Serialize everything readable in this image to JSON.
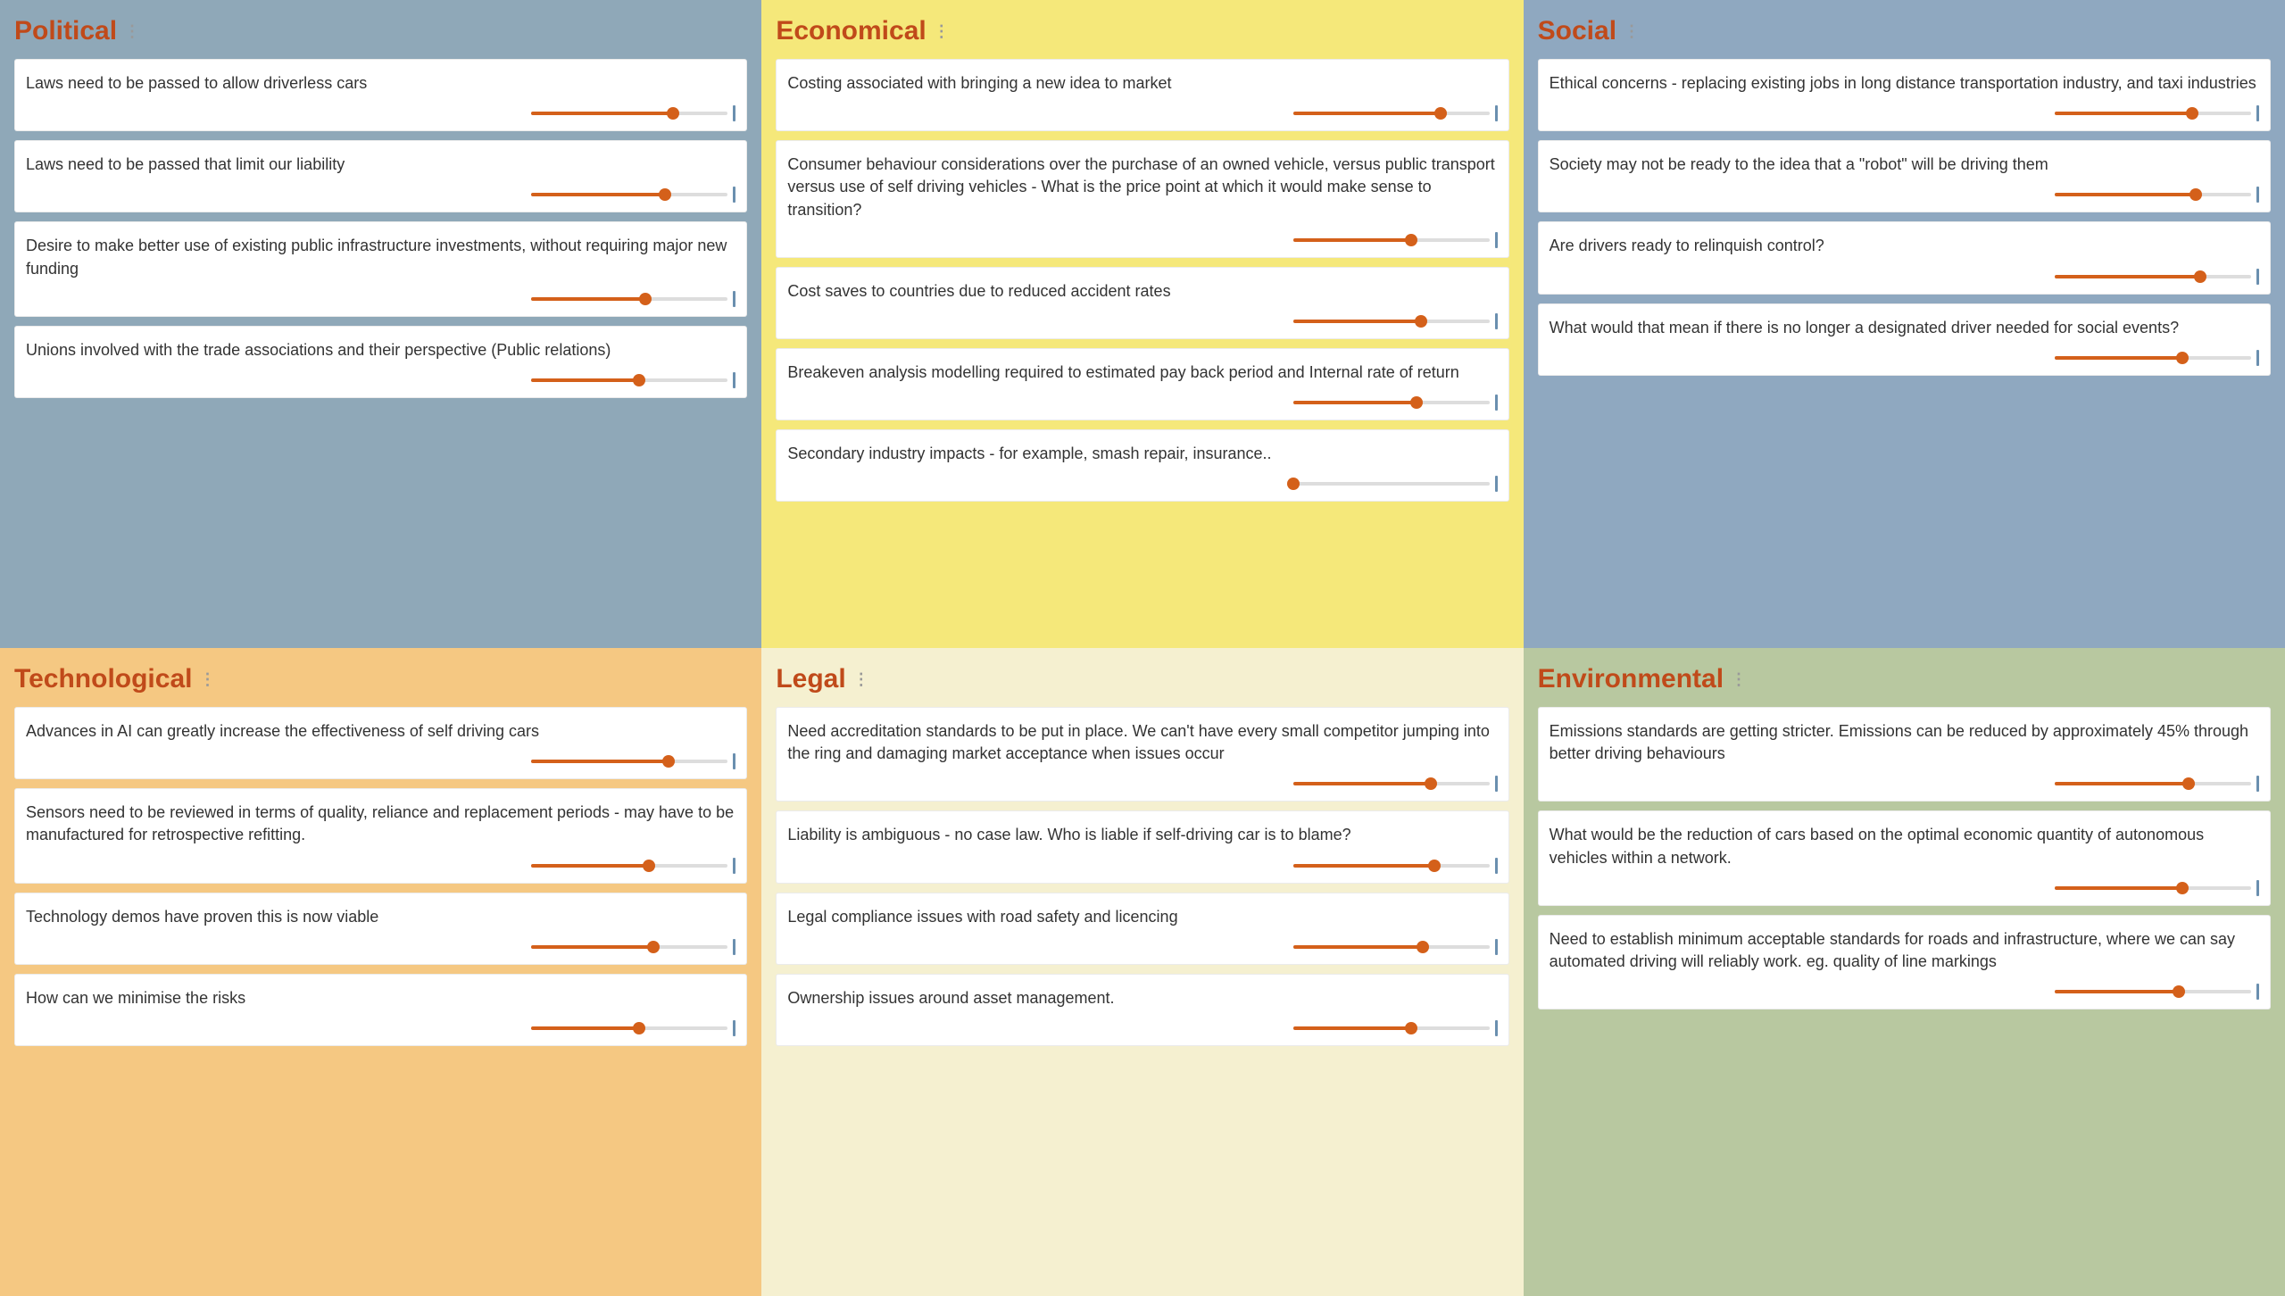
{
  "columns": [
    {
      "id": "political",
      "label": "Political",
      "colorClass": "col-political",
      "cards": [
        {
          "text": "Laws need to be passed to allow driverless cars",
          "sliderPos": 72
        },
        {
          "text": "Laws need to be passed that limit our liability",
          "sliderPos": 68
        },
        {
          "text": "Desire to make better use of existing public infrastructure investments, without requiring major new funding",
          "sliderPos": 58
        },
        {
          "text": "Unions involved with the trade associations and their perspective (Public relations)",
          "sliderPos": 55
        }
      ]
    },
    {
      "id": "economical",
      "label": "Economical",
      "colorClass": "col-economical",
      "cards": [
        {
          "text": "Costing associated with bringing a new idea to market",
          "sliderPos": 75
        },
        {
          "text": "Consumer behaviour considerations over the purchase of an owned vehicle, versus public transport versus use of self driving vehicles - What is the price point at which it would make sense to transition?",
          "sliderPos": 60
        },
        {
          "text": "Cost saves to countries due to reduced accident rates",
          "sliderPos": 65
        },
        {
          "text": "Breakeven analysis modelling required to estimated pay back period and Internal rate of return",
          "sliderPos": 63
        },
        {
          "text": "Secondary industry impacts - for example, smash repair, insurance..",
          "sliderPos": 0
        }
      ]
    },
    {
      "id": "social",
      "label": "Social",
      "colorClass": "col-social",
      "cards": [
        {
          "text": "Ethical concerns - replacing existing jobs in long distance transportation industry, and taxi industries",
          "sliderPos": 70
        },
        {
          "text": "Society may not be ready to the idea that a \"robot\" will be driving them",
          "sliderPos": 72
        },
        {
          "text": "Are drivers ready to relinquish control?",
          "sliderPos": 74
        },
        {
          "text": "What would that mean if there is no longer a designated driver needed for social events?",
          "sliderPos": 65
        }
      ]
    },
    {
      "id": "technological",
      "label": "Technological",
      "colorClass": "col-technological",
      "cards": [
        {
          "text": "Advances in AI can greatly increase the effectiveness of self driving cars",
          "sliderPos": 70
        },
        {
          "text": "Sensors need to be reviewed in terms of quality, reliance and replacement periods - may have to be manufactured for retrospective refitting.",
          "sliderPos": 60
        },
        {
          "text": "Technology demos have proven this is now viable",
          "sliderPos": 62
        },
        {
          "text": "How can we minimise the risks",
          "sliderPos": 55
        }
      ]
    },
    {
      "id": "legal",
      "label": "Legal",
      "colorClass": "col-legal",
      "cards": [
        {
          "text": "Need accreditation standards to be put in place. We can't have every small competitor jumping into the ring and damaging market acceptance when issues occur",
          "sliderPos": 70
        },
        {
          "text": "Liability is ambiguous - no case law. Who is liable if self-driving car is to blame?",
          "sliderPos": 72
        },
        {
          "text": "Legal compliance issues with road safety and licencing",
          "sliderPos": 66
        },
        {
          "text": "Ownership issues around asset management.",
          "sliderPos": 60
        }
      ]
    },
    {
      "id": "environmental",
      "label": "Environmental",
      "colorClass": "col-environmental",
      "cards": [
        {
          "text": "Emissions standards are getting stricter. Emissions can be reduced by approximately 45% through better driving behaviours",
          "sliderPos": 68
        },
        {
          "text": "What would be the reduction of cars based on the optimal economic quantity of autonomous vehicles within a network.",
          "sliderPos": 65
        },
        {
          "text": "Need to establish minimum acceptable standards for roads and infrastructure, where we can say automated driving will reliably work. eg. quality of line markings",
          "sliderPos": 63
        }
      ]
    }
  ],
  "dragIconLabel": "⋮⋮"
}
